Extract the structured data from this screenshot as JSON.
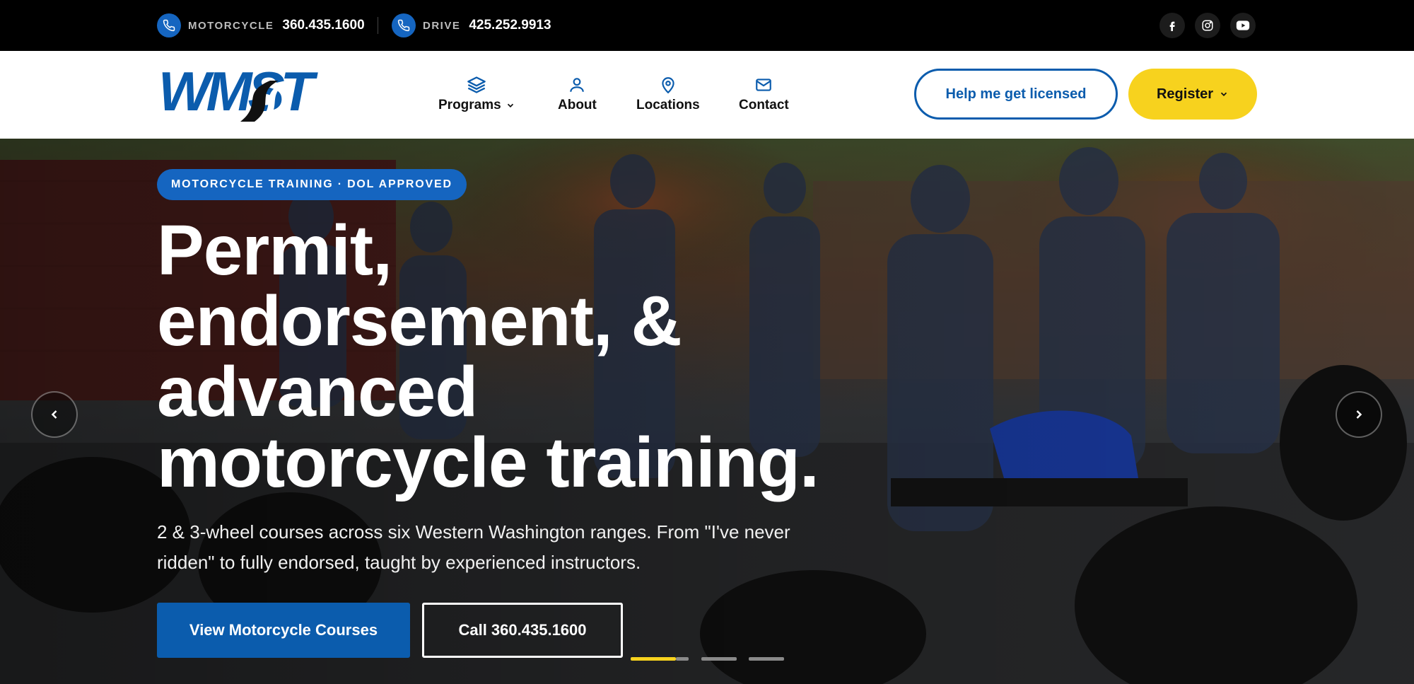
{
  "topbar": {
    "motorcycle": {
      "kicker": "MOTORCYCLE",
      "number": "360.435.1600"
    },
    "drive": {
      "kicker": "DRIVE",
      "number": "425.252.9913"
    },
    "social": [
      "facebook-icon",
      "instagram-icon",
      "youtube-icon"
    ]
  },
  "header": {
    "logo_text": "WMST",
    "nav": [
      {
        "label": "Programs",
        "icon": "layers-icon",
        "has_dropdown": true
      },
      {
        "label": "About",
        "icon": "user-icon",
        "has_dropdown": false
      },
      {
        "label": "Locations",
        "icon": "map-pin-icon",
        "has_dropdown": false
      },
      {
        "label": "Contact",
        "icon": "mail-icon",
        "has_dropdown": false
      }
    ],
    "help_button": "Help me get licensed",
    "register_button": "Register"
  },
  "hero": {
    "badge": "MOTORCYCLE TRAINING · DOL APPROVED",
    "headline_lines": [
      "Permit,",
      "endorsement, &",
      "advanced",
      "motorcycle training."
    ],
    "subtext": "2 & 3-wheel courses across six Western Washington ranges. From \"I've never ridden\" to fully endorsed, taught by experienced instructors.",
    "cta_primary": "View Motorcycle Courses",
    "cta_secondary": "Call 360.435.1600",
    "slides_total": 3,
    "active_slide": 1
  },
  "colors": {
    "brand_blue": "#1565c0",
    "accent_yellow": "#f7d21e",
    "topbar_bg": "#000000"
  }
}
